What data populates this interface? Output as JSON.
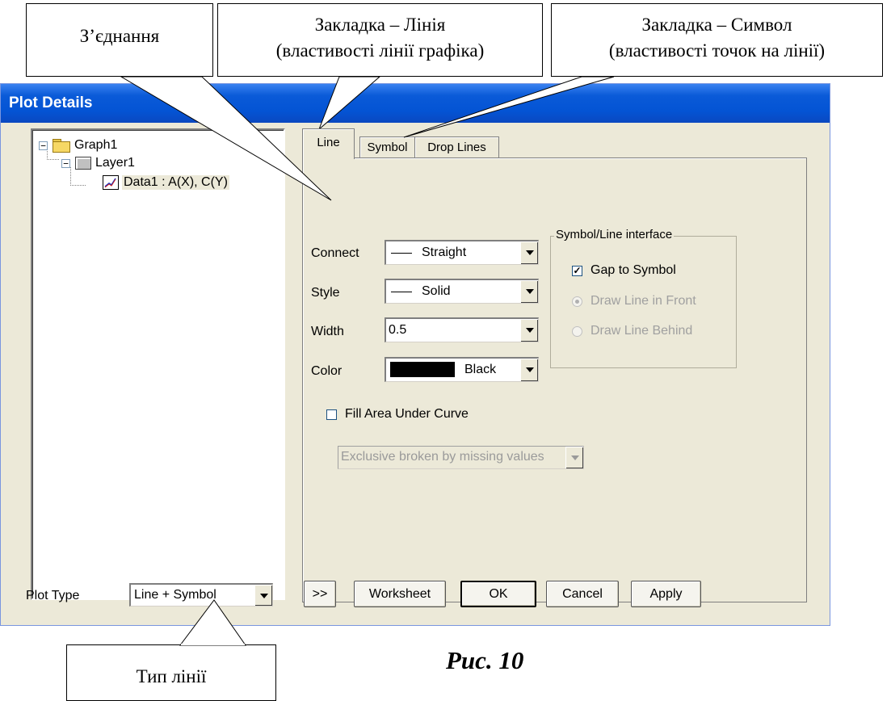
{
  "dialog": {
    "title": "Plot Details",
    "tree": {
      "graph": "Graph1",
      "layer": "Layer1",
      "data": "Data1 : A(X), C(Y)"
    },
    "tabs": [
      "Line",
      "Symbol",
      "Drop Lines"
    ],
    "line_tab": {
      "connect_label": "Connect",
      "connect_value": "Straight",
      "style_label": "Style",
      "style_value": "Solid",
      "width_label": "Width",
      "width_value": "0.5",
      "color_label": "Color",
      "color_value": "Black",
      "color_swatch": "#000000",
      "fill_label": "Fill Area Under Curve",
      "fill_checked": false,
      "fill_mode": "Exclusive broken by missing values",
      "interface_group": "Symbol/Line interface",
      "gap_label": "Gap to Symbol",
      "gap_checked": true,
      "front_label": "Draw Line in Front",
      "behind_label": "Draw Line Behind"
    },
    "bottom": {
      "plot_type_label": "Plot Type",
      "plot_type_value": "Line + Symbol",
      "more_button": ">>",
      "worksheet_button": "Worksheet",
      "ok_button": "OK",
      "cancel_button": "Cancel",
      "apply_button": "Apply"
    }
  },
  "annotations": {
    "connection": "З’єднання",
    "line_tab_1": "Закладка – Лінія",
    "line_tab_2": "(властивості лінії графіка)",
    "symbol_tab_1": "Закладка – Символ",
    "symbol_tab_2": "(властивості точок на лінії)",
    "line_type": "Тип лінії",
    "figure": "Рис. 10"
  },
  "colors": {
    "title_bar": "#0454d4",
    "dialog_bg": "#ece9d8"
  }
}
